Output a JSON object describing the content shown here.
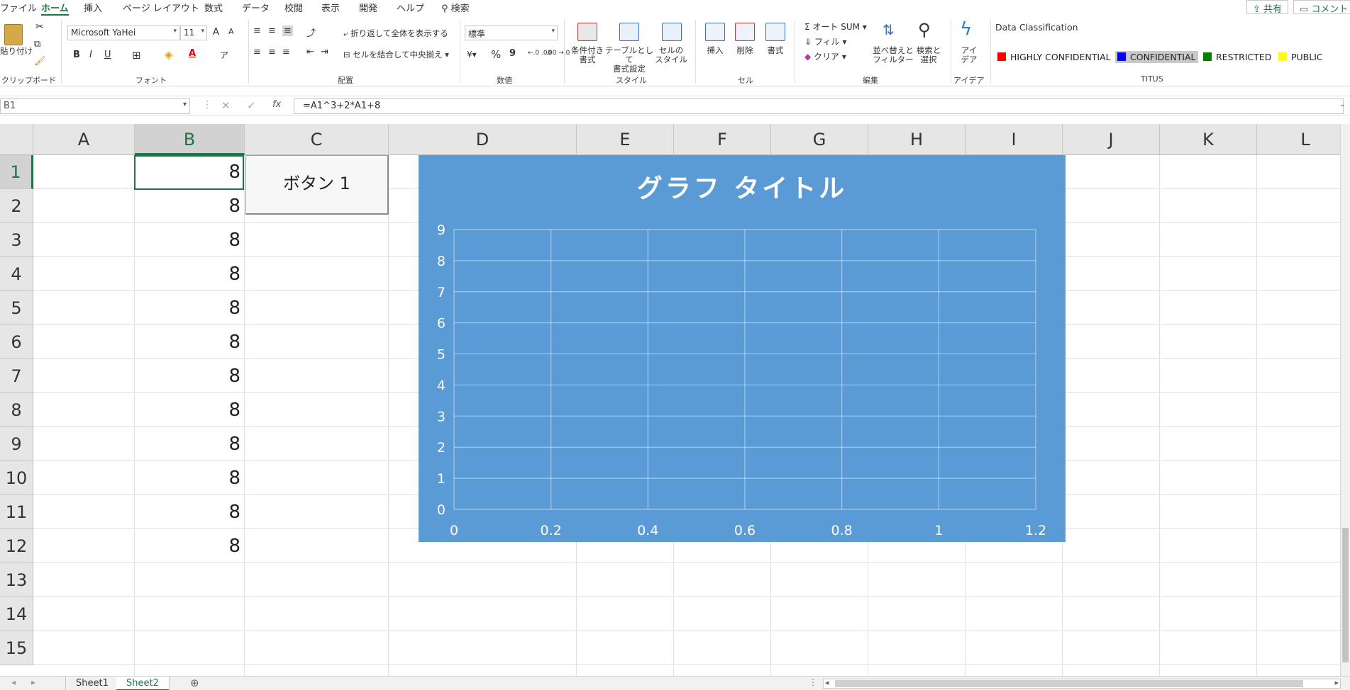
{
  "menu": {
    "tabs": [
      "ファイル",
      "ホーム",
      "挿入",
      "ページ レイアウト",
      "数式",
      "データ",
      "校閲",
      "表示",
      "開発",
      "ヘルプ"
    ],
    "active_tab": "ホーム",
    "search": "検索",
    "share": "共有",
    "comment": "コメント"
  },
  "ribbon": {
    "clipboard": {
      "paste": "貼り付け",
      "label": "クリップボード"
    },
    "font": {
      "name": "Microsoft YaHei",
      "size": "11",
      "grow": "A",
      "shrink": "A",
      "bold": "B",
      "italic": "I",
      "underline": "U",
      "label": "フォント"
    },
    "alignment": {
      "wrap": "折り返して全体を表示する",
      "merge": "セルを結合して中央揃え",
      "label": "配置"
    },
    "number": {
      "format": "標準",
      "percent": "%",
      "comma": "9",
      "dec_inc": "←.0 .00",
      "dec_dec": ".00 →.0",
      "label": "数値"
    },
    "styles": {
      "conditional": "条件付き\n書式",
      "table": "テーブルとして\n書式設定",
      "cell": "セルの\nスタイル",
      "label": "スタイル"
    },
    "cells": {
      "insert": "挿入",
      "delete": "削除",
      "format": "書式",
      "label": "セル"
    },
    "editing": {
      "autosum": "オート SUM",
      "fill": "フィル",
      "clear": "クリア",
      "sort": "並べ替えと\nフィルター",
      "find": "検索と\n選択",
      "label": "編集"
    },
    "ideas": {
      "ideas": "アイ\nデア",
      "label": "アイデア"
    },
    "titus": {
      "heading": "Data Classification",
      "items": [
        {
          "label": "HIGHLY CONFIDENTIAL",
          "color": "#ff0000"
        },
        {
          "label": "CONFIDENTIAL",
          "color": "#0000ff"
        },
        {
          "label": "RESTRICTED",
          "color": "#008000"
        },
        {
          "label": "PUBLIC",
          "color": "#ffff00"
        }
      ],
      "selected": "CONFIDENTIAL",
      "label": "TITUS"
    }
  },
  "formula_bar": {
    "name_box": "B1",
    "formula": "=A1^3+2*A1+8"
  },
  "columns": [
    "A",
    "B",
    "C",
    "D",
    "E",
    "F",
    "G",
    "H",
    "I",
    "J",
    "K",
    "L"
  ],
  "rows": [
    "1",
    "2",
    "3",
    "4",
    "5",
    "6",
    "7",
    "8",
    "9",
    "10",
    "11",
    "12",
    "13",
    "14",
    "15"
  ],
  "selected_cell": "B1",
  "cells_B": [
    "8",
    "8",
    "8",
    "8",
    "8",
    "8",
    "8",
    "8",
    "8",
    "8",
    "8",
    "8"
  ],
  "form_button": {
    "label": "ボタン 1"
  },
  "chart_data": {
    "type": "scatter",
    "title": "グラフ タイトル",
    "series": [],
    "xlim": [
      0,
      1.2
    ],
    "ylim": [
      0,
      9
    ],
    "x_ticks": [
      "0",
      "0.2",
      "0.4",
      "0.6",
      "0.8",
      "1",
      "1.2"
    ],
    "y_ticks": [
      "0",
      "1",
      "2",
      "3",
      "4",
      "5",
      "6",
      "7",
      "8",
      "9"
    ],
    "grid": true,
    "background": "#5b9bd5",
    "text_color": "#ffffff"
  },
  "sheets": [
    "Sheet1",
    "Sheet2"
  ],
  "active_sheet": "Sheet2",
  "colors": {
    "accent": "#217346"
  }
}
